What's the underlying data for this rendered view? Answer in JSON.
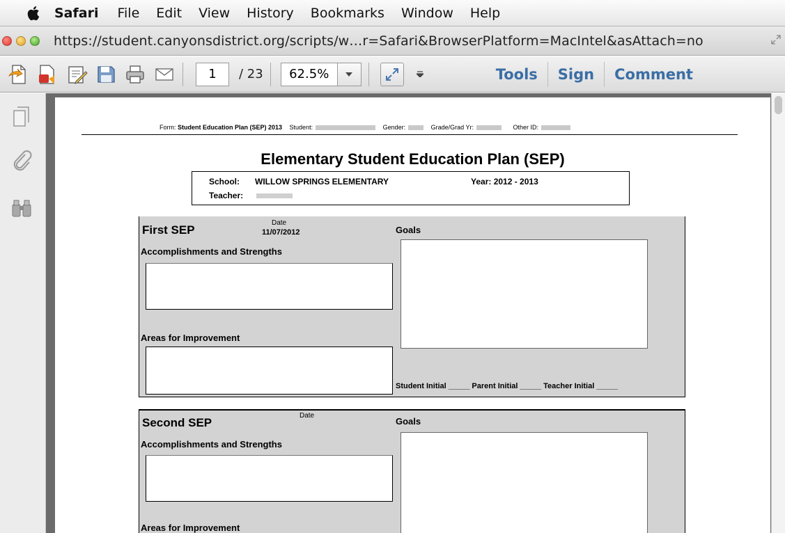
{
  "menubar": {
    "app": "Safari",
    "items": [
      "File",
      "Edit",
      "View",
      "History",
      "Bookmarks",
      "Window",
      "Help"
    ]
  },
  "address": {
    "url": "https://student.canyonsdistrict.org/scripts/w…r=Safari&BrowserPlatform=MacIntel&asAttach=no"
  },
  "toolbar": {
    "page_current": "1",
    "page_total": "/ 23",
    "zoom": "62.5%",
    "tools_label": "Tools",
    "sign_label": "Sign",
    "comment_label": "Comment"
  },
  "document": {
    "form_label": "Form: ",
    "form_name": "Student Education Plan (SEP) 2013",
    "student_label": "Student:",
    "gender_label": "Gender:",
    "grade_label": "Grade/Grad Yr:",
    "other_id_label": "Other ID:",
    "title": "Elementary Student Education Plan (SEP)",
    "school_label": "School:",
    "school_name": "WILLOW SPRINGS ELEMENTARY",
    "year_label": "Year: 2012 - 2013",
    "teacher_label": "Teacher:",
    "sections": [
      {
        "title": "First SEP",
        "date_label": "Date",
        "date_value": "11/07/2012",
        "goals_label": "Goals",
        "accomplishments_label": "Accomplishments and Strengths",
        "improvement_label": "Areas for Improvement",
        "initials": "Student Initial _____  Parent Initial _____  Teacher Initial _____"
      },
      {
        "title": "Second SEP",
        "date_label": "Date",
        "date_value": "",
        "goals_label": "Goals",
        "accomplishments_label": "Accomplishments and Strengths",
        "improvement_label": "Areas for Improvement"
      }
    ]
  },
  "colors": {
    "link_blue": "#3a6ea5",
    "section_gray": "#d3d3d3",
    "viewer_gray": "#6b6b6b"
  }
}
